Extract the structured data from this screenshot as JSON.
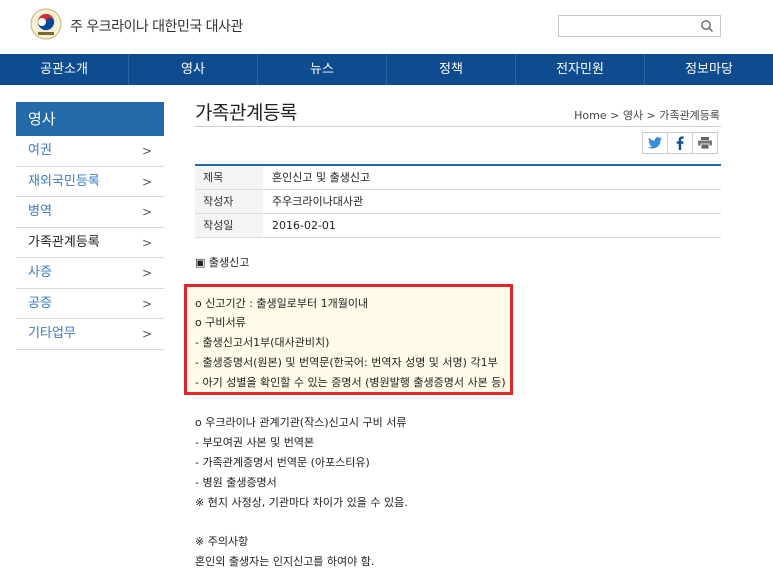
{
  "header": {
    "site_title": "주 우크라이나 대한민국 대사관",
    "search_placeholder": ""
  },
  "gnb": {
    "items": [
      "공관소개",
      "영사",
      "뉴스",
      "정책",
      "전자민원",
      "정보마당"
    ]
  },
  "lnb": {
    "title": "영사",
    "items": [
      {
        "label": "여권"
      },
      {
        "label": "재외국민등록"
      },
      {
        "label": "병역"
      },
      {
        "label": "가족관계등록"
      },
      {
        "label": "사증"
      },
      {
        "label": "공증"
      },
      {
        "label": "기타업무"
      }
    ],
    "arrow": ">"
  },
  "content": {
    "page_title": "가족관계등록",
    "breadcrumb": "Home > 영사 > 가족관계등록",
    "table": [
      {
        "label": "제목",
        "value": "혼인신고 및 출생신고"
      },
      {
        "label": "작성자",
        "value": "주우크라이나대사관"
      },
      {
        "label": "작성일",
        "value": "2016-02-01"
      }
    ],
    "section_title": "▣ 출생신고",
    "highlight_lines": [
      "o  신고기간 : 출생일로부터 1개월이내",
      "o  구비서류",
      "  - 출생신고서1부(대사관비치)",
      "  - 출생증명서(원본) 및 번역문(한국어: 번역자 성명 및 서명) 각1부",
      "  - 아기 성별을 확인할 수 있는 증명서 (병원발행 출생증명서 사본 등)"
    ],
    "lines_after": [
      "o  우크라이나 관계기관(작스)신고시 구비 서류",
      "  - 부모여권 사본 및 번역본",
      "  - 가족관계증명서 번역문 (아포스티유)",
      "  - 병원 출생증명서",
      "※ 현지 사정상, 기관마다 차이가 있을 수 있음."
    ],
    "notice_title": "※  주의사항",
    "notice_text": "   혼인외 출생자는 인지신고를 하여야 함."
  },
  "colors": {
    "nav_bg": "#0e4b8f",
    "lnb_title_bg": "#2469a8",
    "lnb_link": "#3a7bc4",
    "highlight_border": "#e2252b"
  },
  "icons": {
    "search": "search-icon",
    "twitter": "twitter-icon",
    "facebook": "facebook-icon",
    "print": "print-icon"
  }
}
